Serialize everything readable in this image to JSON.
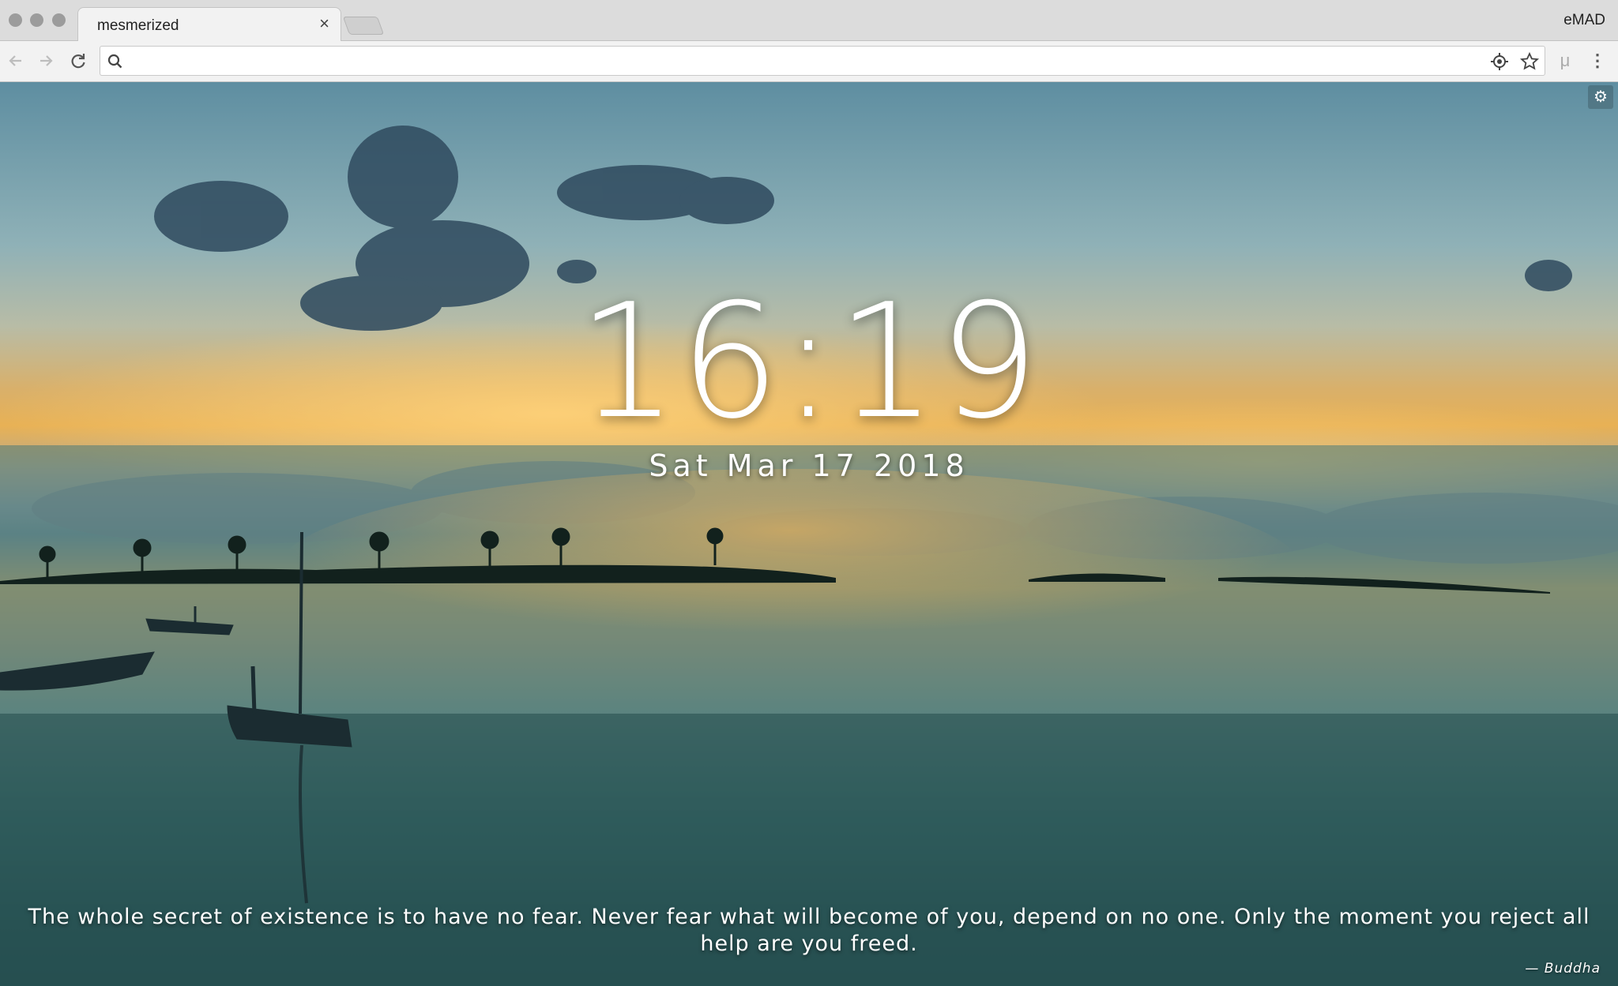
{
  "browser": {
    "tab_title": "mesmerized",
    "tab_close_glyph": "×",
    "profile_name": "eMAD",
    "address_value": "",
    "icons": {
      "back": "back-arrow-icon",
      "forward": "forward-arrow-icon",
      "reload": "reload-icon",
      "search": "search-icon",
      "location": "location-target-icon",
      "bookmark": "star-icon",
      "extension": "extension-mu-icon",
      "menu": "kebab-menu-icon"
    },
    "extension_glyph": "μ",
    "menu_glyph": "⋮"
  },
  "page": {
    "settings_glyph": "⚙",
    "time": "16:19",
    "date": "Sat Mar 17 2018",
    "quote": "The whole secret of existence is to have no fear. Never fear what will become of you, depend on no one. Only the moment you reject all help are you freed.",
    "quote_author": "—  Buddha"
  },
  "colors": {
    "chrome_bg": "#dcdcdc",
    "text_light": "#ffffff"
  }
}
